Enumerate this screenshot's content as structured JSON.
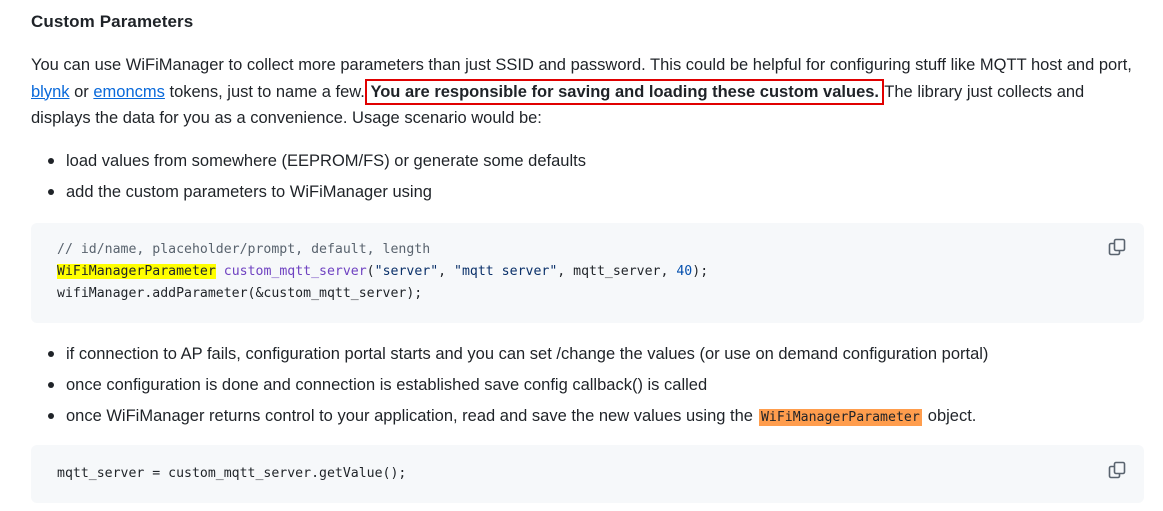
{
  "heading": "Custom Parameters",
  "paragraph": {
    "text_1": "You can use WiFiManager to collect more parameters than just SSID and password. This could be helpful for configuring stuff like MQTT host and port, ",
    "link_1": "blynk",
    "text_2": " or ",
    "link_2": "emoncms",
    "text_3": " tokens, just to name a few. ",
    "boxed": "You are responsible for saving and loading these custom values.",
    "text_4": " The library just collects and displays the data for you as a convenience. Usage scenario would be:"
  },
  "bullets_1": [
    "load values from somewhere (EEPROM/FS) or generate some defaults",
    "add the custom parameters to WiFiManager using"
  ],
  "code_1": {
    "line_1": "// id/name, placeholder/prompt, default, length",
    "line_2_type": "WiFiManagerParameter",
    "line_2_fn": "custom_mqtt_server",
    "line_2_open": "(",
    "line_2_str1": "\"server\"",
    "line_2_sep1": ", ",
    "line_2_str2": "\"mqtt server\"",
    "line_2_rest": ", mqtt_server, ",
    "line_2_num": "40",
    "line_2_close": ");",
    "line_3": "wifiManager.addParameter(&custom_mqtt_server);"
  },
  "bullets_2": {
    "item_1": "if connection to AP fails, configuration portal starts and you can set /change the values (or use on demand configuration portal)",
    "item_2": "once configuration is done and connection is established save config callback() is called",
    "item_3_pre": "once WiFiManager returns control to your application, read and save the new values using the",
    "item_3_code": "WiFiManagerParameter",
    "item_3_post": "object."
  },
  "code_2": {
    "line_1": "mqtt_server = custom_mqtt_server.getValue();"
  },
  "icons": {
    "copy": "copy-icon"
  },
  "colors": {
    "link": "#0969da",
    "highlight_yellow": "#ffff00",
    "highlight_orange": "#ff9d4d",
    "box_border": "#e00000",
    "code_bg": "#f6f8fa"
  }
}
